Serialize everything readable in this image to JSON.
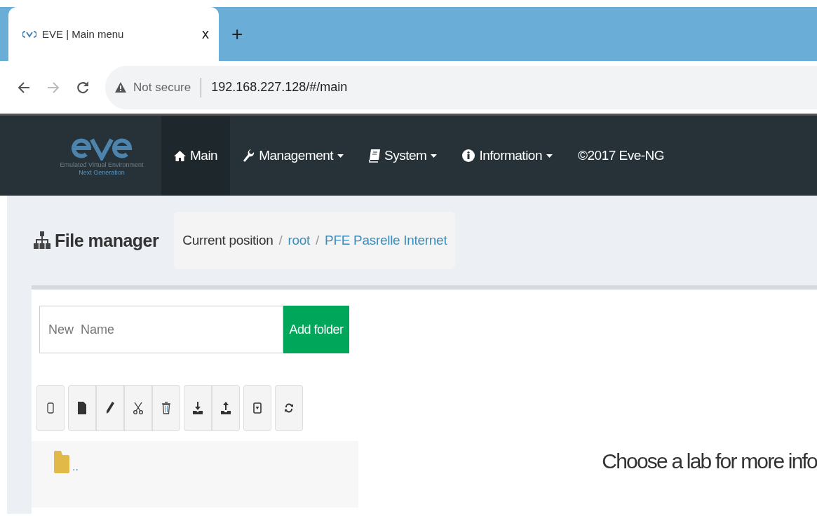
{
  "browser": {
    "tab": {
      "title": "EVE | Main menu",
      "close": "x"
    },
    "new_tab": "+",
    "address": {
      "security": "Not secure",
      "url": "192.168.227.128/#/main"
    }
  },
  "navbar": {
    "logo": {
      "tagline": "Emulated Virtual Environment",
      "subtitle": "Next Generation"
    },
    "items": [
      {
        "label": "Main",
        "selected": true,
        "dropdown": false,
        "kind": "home"
      },
      {
        "label": "Management",
        "selected": false,
        "dropdown": true,
        "kind": "wrench"
      },
      {
        "label": "System",
        "selected": false,
        "dropdown": true,
        "kind": "book"
      },
      {
        "label": "Information",
        "selected": false,
        "dropdown": true,
        "kind": "info"
      },
      {
        "label": "©2017 Eve-NG",
        "selected": false,
        "dropdown": false,
        "kind": "text"
      }
    ]
  },
  "header": {
    "title": "File manager",
    "breadcrumb": {
      "label": "Current position",
      "links": [
        {
          "separator": "/",
          "text": "root"
        },
        {
          "separator": "/",
          "text": "PFE Pasrelle Internet"
        }
      ]
    }
  },
  "file_panel": {
    "new_name": {
      "placeholder": "New  Name"
    },
    "add_button": "Add folder",
    "entries": [
      {
        "name": ".."
      }
    ]
  },
  "info_panel": {
    "message": "Choose a lab for more info"
  }
}
